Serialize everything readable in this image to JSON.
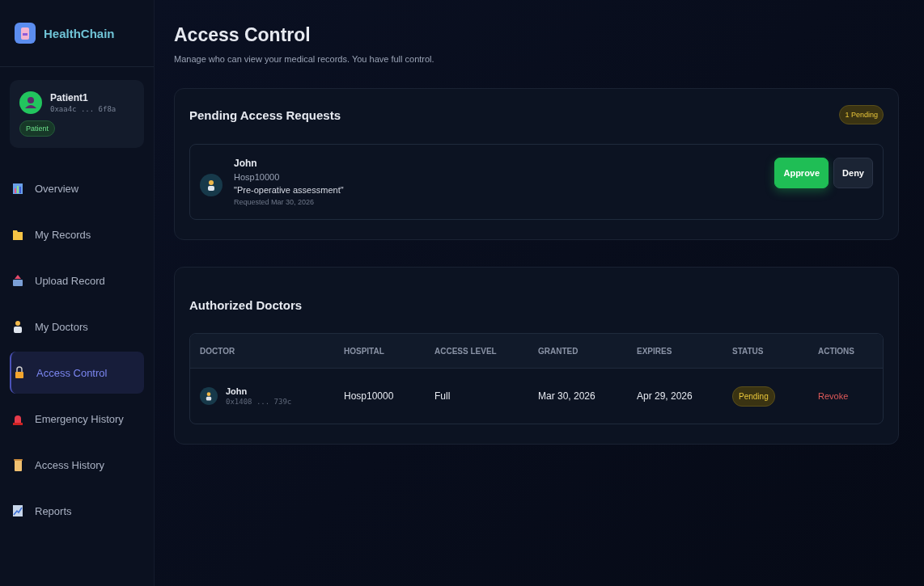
{
  "sidebar": {
    "brand": "HealthChain",
    "user": {
      "name": "Patient1",
      "address": "0xaa4c ... 6f8a",
      "role": "Patient"
    },
    "items": [
      {
        "label": "Overview",
        "selected": false
      },
      {
        "label": "My Records",
        "selected": false
      },
      {
        "label": "Upload Record",
        "selected": false
      },
      {
        "label": "My Doctors",
        "selected": false
      },
      {
        "label": "Access Control",
        "selected": true
      },
      {
        "label": "Emergency History",
        "selected": false
      },
      {
        "label": "Access History",
        "selected": false
      },
      {
        "label": "Reports",
        "selected": false
      }
    ]
  },
  "page": {
    "title": "Access Control",
    "subtitle": "Manage who can view your medical records. You have full control."
  },
  "pending": {
    "title": "Pending Access Requests",
    "badge": "1 Pending",
    "requests": [
      {
        "name": "John",
        "hospital": "Hosp10000",
        "reason": "\"Pre-operative assessment\"",
        "requested": "Requested Mar 30, 2026",
        "actions": [
          "Approve",
          "Deny"
        ]
      }
    ]
  },
  "authorized": {
    "title": "Authorized Doctors",
    "columns": [
      "DOCTOR",
      "HOSPITAL",
      "ACCESS LEVEL",
      "GRANTED",
      "EXPIRES",
      "STATUS",
      "ACTIONS"
    ],
    "rows": [
      {
        "name": "John",
        "address": "0x1408 ... 739c",
        "hospital": "Hosp10000",
        "access_level": "Full",
        "granted": "Mar 30, 2026",
        "expires": "Apr 29, 2026",
        "status": "Pending",
        "action": "Revoke"
      }
    ]
  }
}
